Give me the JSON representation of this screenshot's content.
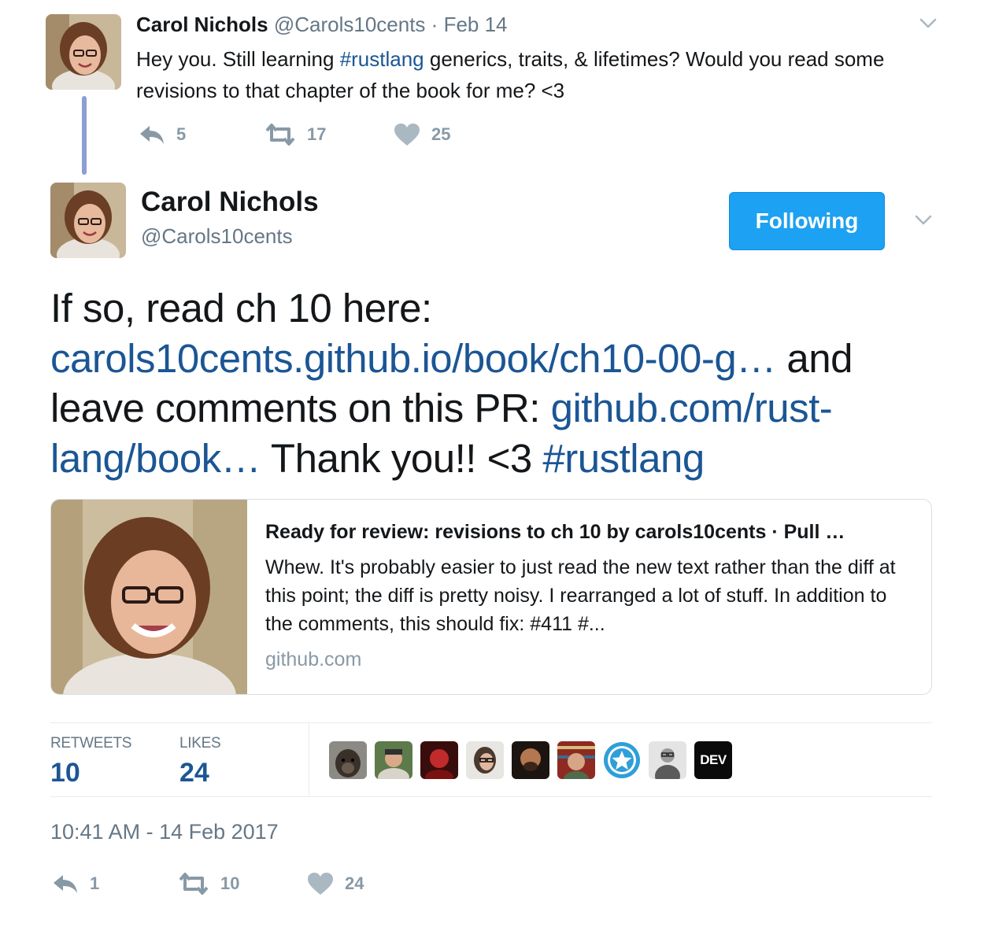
{
  "parent_tweet": {
    "name": "Carol Nichols",
    "handle": "@Carols10cents",
    "separator": "·",
    "date": "Feb 14",
    "text_1": "Hey you. Still learning ",
    "hashtag": "#rustlang",
    "text_2": " generics, traits, & lifetimes? Would you read some revisions to that chapter of the book for me? <3",
    "replies": "5",
    "retweets": "17",
    "likes": "25"
  },
  "main_tweet": {
    "name": "Carol Nichols",
    "handle": "@Carols10cents",
    "follow_label": "Following",
    "text_1": "If so, read ch 10 here: ",
    "link_1": "carols10cents.github.io/book/ch10-00-g…",
    "text_2": " and leave comments on this PR: ",
    "link_2": "github.com/rust-lang/book…",
    "text_3": " Thank you!! <3 ",
    "hashtag": "#rustlang"
  },
  "card": {
    "title": "Ready for review: revisions to ch 10 by carols10cents · Pull …",
    "description": "Whew. It's probably easier to just read the new text rather than the diff at this point; the diff is pretty noisy. I rearranged a lot of stuff. In addition to the comments, this should fix: #411 #...",
    "domain": "github.com"
  },
  "stats": {
    "retweets_label": "RETWEETS",
    "retweets_value": "10",
    "likes_label": "LIKES",
    "likes_value": "24",
    "likers": [
      {
        "name": "liker-dog-avatar"
      },
      {
        "name": "liker-man-outdoors-avatar"
      },
      {
        "name": "liker-red-photo-avatar"
      },
      {
        "name": "liker-woman-glasses-avatar"
      },
      {
        "name": "liker-man-dark-avatar"
      },
      {
        "name": "liker-man-bookshelf-avatar"
      },
      {
        "name": "liker-blue-star-avatar"
      },
      {
        "name": "liker-man-bw-avatar"
      },
      {
        "name": "liker-dev-avatar",
        "label": "DEV"
      }
    ]
  },
  "timestamp": "10:41 AM - 14 Feb 2017",
  "main_actions": {
    "replies": "1",
    "retweets": "10",
    "likes": "24"
  },
  "colors": {
    "link": "#1b5694",
    "follow_button": "#1da1f2",
    "thread_line": "#8b9fd1",
    "muted": "#657786",
    "action_gray": "#8899a6"
  }
}
